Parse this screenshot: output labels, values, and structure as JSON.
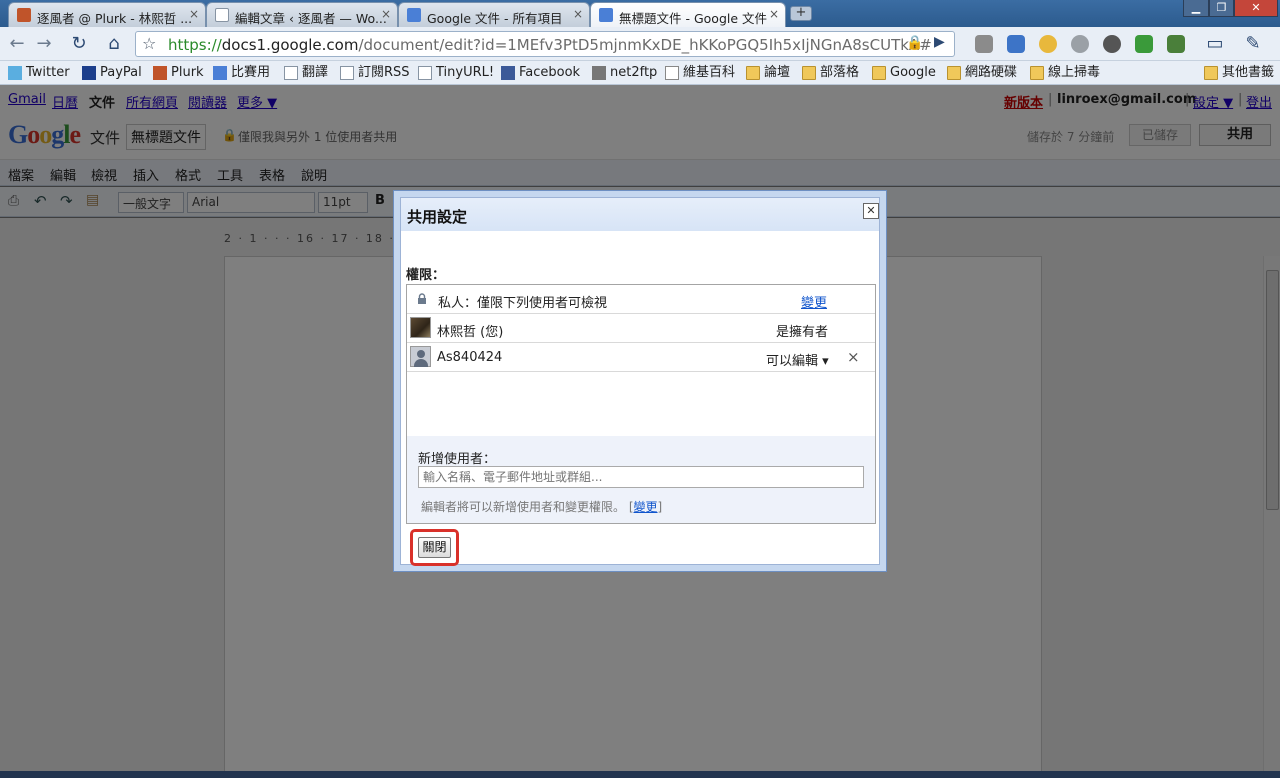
{
  "browser": {
    "tabs": [
      {
        "title": "逐風者 @ Plurk - 林熙哲 ...",
        "close": "×"
      },
      {
        "title": "編輯文章 ‹ 逐風者 — Wo...",
        "close": "×"
      },
      {
        "title": "Google 文件 - 所有項目",
        "close": "×"
      },
      {
        "title": "無標題文件 - Google 文件",
        "close": "×"
      }
    ],
    "new_tab": "+",
    "url_scheme": "https://",
    "url_host": "docs1.google.com",
    "url_path": "/document/edit?id=1MEfv3PtD5mjnmKxDE_hKKoPGQ5Ih5xIjNGnA8sCUTkA#"
  },
  "bookmarks": [
    "Twitter",
    "PayPal",
    "Plurk",
    "比賽用",
    "翻譯",
    "訂閱RSS",
    "TinyURL!",
    "Facebook",
    "net2ftp",
    "維基百科",
    "論壇",
    "部落格",
    "Google",
    "網路硬碟",
    "線上掃毒",
    "其他書籤"
  ],
  "gbar": {
    "left": [
      "Gmail",
      "日曆",
      "文件",
      "所有網頁",
      "閱讀器",
      "更多 ▼"
    ],
    "new_version": "新版本",
    "email": "linroex@gmail.com",
    "settings": "設定 ▼",
    "signout": "登出"
  },
  "docs": {
    "logo": "Google",
    "product": "文件",
    "doc_title": "無標題文件",
    "sharing_status": "僅限我與另外 1 位使用者共用",
    "saved_status": "儲存於 7 分鐘前",
    "saved_button": "已儲存",
    "share_button": "共用",
    "menus": [
      "檔案",
      "編輯",
      "檢視",
      "插入",
      "格式",
      "工具",
      "表格",
      "說明"
    ],
    "style_select": "一般文字",
    "font_select": "Arial",
    "size_select": "11pt",
    "bold": "B",
    "ruler": "2 · 1 · · · 16 · 17 · 18 · 19"
  },
  "dialog": {
    "title": "共用設定",
    "permissions_label": "權限：",
    "visibility": "私人：僅限下列使用者可檢視",
    "change": "變更",
    "users": [
      {
        "name": "林熙哲 (您)",
        "role": "是擁有者"
      },
      {
        "name": "As840424",
        "role": "可以編輯",
        "remove": "×"
      }
    ],
    "add_label": "新增使用者：",
    "add_placeholder": "輸入名稱、電子郵件地址或群組...",
    "editor_note": "編輯者將可以新增使用者和變更權限。",
    "editor_note_link": "變更",
    "close_button": "關閉"
  }
}
